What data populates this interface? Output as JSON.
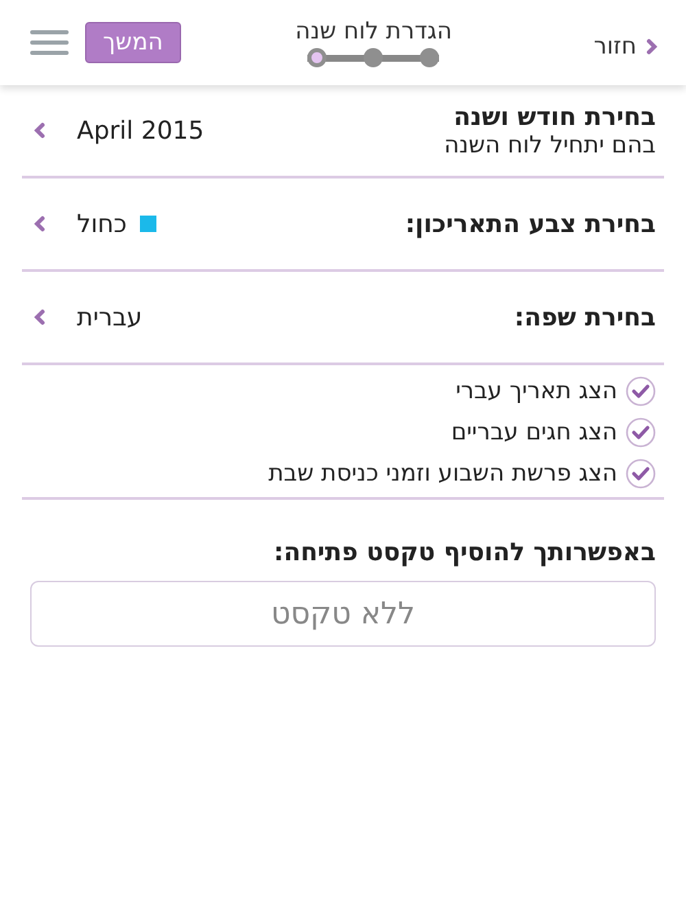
{
  "header": {
    "back_label": "חזור",
    "title": "הגדרת לוח שנה",
    "steps": [
      {
        "selected": false
      },
      {
        "selected": false
      },
      {
        "selected": true
      }
    ],
    "next_button": "המשך"
  },
  "month_row": {
    "title": "בחירת חודש ושנה",
    "subtitle": "בהם יתחיל לוח השנה",
    "value": "April 2015"
  },
  "color_row": {
    "title": "בחירת צבע התאריכון:",
    "value": "כחול",
    "color": "#1bb9ea"
  },
  "language_row": {
    "title": "בחירת שפה:",
    "value": "עברית"
  },
  "options": [
    {
      "label": "הצג תאריך עברי",
      "checked": true
    },
    {
      "label": "הצג חגים עבריים",
      "checked": true
    },
    {
      "label": "הצג פרשת השבוע וזמני כניסת שבת",
      "checked": true
    }
  ],
  "opening_text": {
    "label": "באפשרותך להוסיף טקסט פתיחה:",
    "placeholder": "ללא טקסט"
  }
}
